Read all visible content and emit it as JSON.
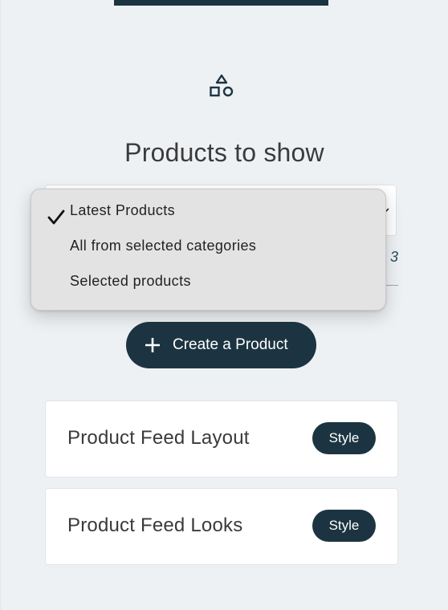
{
  "section": {
    "title": "Products to show",
    "icon": "shapes-icon"
  },
  "products_select": {
    "options": [
      {
        "label": "Latest Products",
        "selected": true
      },
      {
        "label": "All from selected categories",
        "selected": false
      },
      {
        "label": "Selected products",
        "selected": false
      }
    ]
  },
  "count_field": {
    "value": "3"
  },
  "create_button": {
    "label": "Create a Product",
    "icon": "plus-icon"
  },
  "cards": [
    {
      "title": "Product Feed Layout",
      "button_label": "Style"
    },
    {
      "title": "Product Feed Looks",
      "button_label": "Style"
    }
  ],
  "colors": {
    "accent": "#1c3442",
    "background": "#eef1f4",
    "dropdown_bg": "#e3e3e3"
  }
}
